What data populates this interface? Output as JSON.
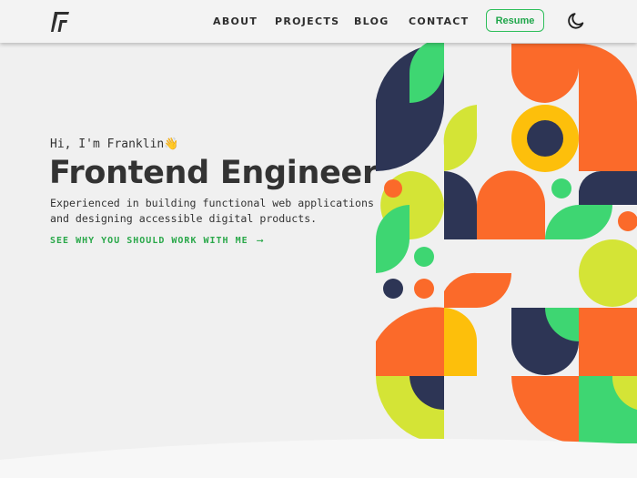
{
  "nav": {
    "logo_icon": "stylized-f-logo-icon",
    "links": [
      "ABOUT",
      "PROJECTS",
      "BLOG",
      "CONTACT"
    ],
    "resume_label": "Resume",
    "theme_icon": "moon-icon"
  },
  "hero": {
    "greeting": "Hi, I'm Franklin👋",
    "title": "Frontend Engineer",
    "description_line1": "Experienced in building functional web applications",
    "description_line2": "and designing accessible digital products.",
    "cta_label": "SEE WHY YOU SHOULD WORK WITH ME",
    "cta_icon": "arrow-right-icon"
  },
  "colors": {
    "navy": "#2d3555",
    "orange": "#fb6a2a",
    "green": "#3ed672",
    "lime": "#d4e436",
    "yellow": "#fdbf0b",
    "accent": "#2aa84a",
    "text": "#333333"
  }
}
